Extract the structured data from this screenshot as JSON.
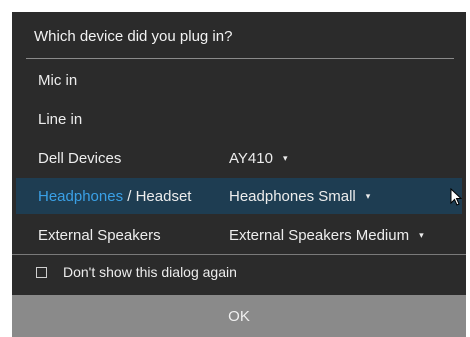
{
  "dialog": {
    "title": "Which device did you plug in?",
    "rows": [
      {
        "label": "Mic in",
        "value": ""
      },
      {
        "label": "Line in",
        "value": ""
      },
      {
        "label": "Dell Devices",
        "value": "AY410"
      },
      {
        "label_part1": "Headphones",
        "label_sep": " / ",
        "label_part2": "Headset",
        "value": "Headphones Small",
        "selected": true
      },
      {
        "label": "External Speakers",
        "value": "External Speakers Medium"
      }
    ],
    "checkbox_label": "Don't show this dialog again",
    "checkbox_checked": false,
    "ok_label": "OK"
  },
  "icons": {
    "dropdown": "chevron-down-icon",
    "cursor": "mouse-pointer-icon"
  },
  "colors": {
    "background": "#2b2b2b",
    "selected_row": "#1e3d52",
    "accent": "#3aa0e6",
    "ok_bar": "#8a8a8a"
  }
}
